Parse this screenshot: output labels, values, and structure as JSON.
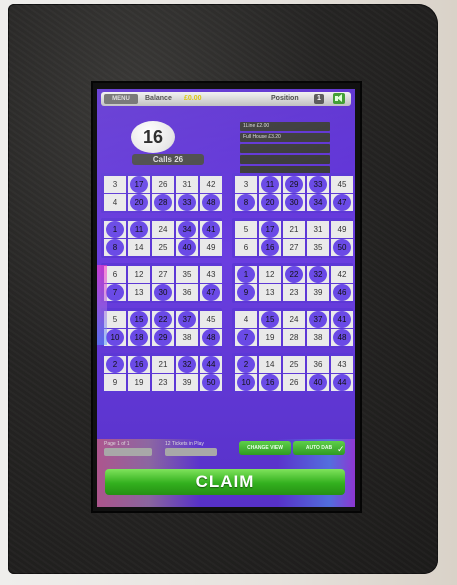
{
  "topbar": {
    "menu_label": "MENU",
    "balance_label": "Balance",
    "balance_value": "£0.00",
    "position_label": "Position",
    "position_value": "1",
    "sound_icon": "speaker-icon"
  },
  "caller": {
    "current_ball": "16",
    "calls_text": "Calls  26"
  },
  "prizes": [
    "1Line £2.00",
    "Full House £3.20",
    "",
    "",
    ""
  ],
  "tickets": [
    [
      {
        "rows": [
          [
            {
              "n": "3",
              "m": false
            },
            {
              "n": "17",
              "m": true
            },
            {
              "n": "26",
              "m": false
            },
            {
              "n": "31",
              "m": false
            },
            {
              "n": "42",
              "m": false
            }
          ],
          [
            {
              "n": "4",
              "m": false
            },
            {
              "n": "20",
              "m": true
            },
            {
              "n": "28",
              "m": true
            },
            {
              "n": "33",
              "m": true
            },
            {
              "n": "48",
              "m": true
            }
          ]
        ]
      },
      {
        "rows": [
          [
            {
              "n": "3",
              "m": false
            },
            {
              "n": "11",
              "m": true
            },
            {
              "n": "29",
              "m": true
            },
            {
              "n": "33",
              "m": true
            },
            {
              "n": "45",
              "m": false
            }
          ],
          [
            {
              "n": "8",
              "m": true
            },
            {
              "n": "20",
              "m": true
            },
            {
              "n": "30",
              "m": true
            },
            {
              "n": "34",
              "m": true
            },
            {
              "n": "47",
              "m": true
            }
          ]
        ]
      }
    ],
    [
      {
        "rows": [
          [
            {
              "n": "1",
              "m": true
            },
            {
              "n": "11",
              "m": true
            },
            {
              "n": "24",
              "m": false
            },
            {
              "n": "34",
              "m": true
            },
            {
              "n": "41",
              "m": true
            }
          ],
          [
            {
              "n": "8",
              "m": true
            },
            {
              "n": "14",
              "m": false
            },
            {
              "n": "25",
              "m": false
            },
            {
              "n": "40",
              "m": true
            },
            {
              "n": "49",
              "m": false
            }
          ]
        ]
      },
      {
        "rows": [
          [
            {
              "n": "5",
              "m": false
            },
            {
              "n": "17",
              "m": true
            },
            {
              "n": "21",
              "m": false
            },
            {
              "n": "31",
              "m": false
            },
            {
              "n": "49",
              "m": false
            }
          ],
          [
            {
              "n": "6",
              "m": false
            },
            {
              "n": "16",
              "m": true
            },
            {
              "n": "27",
              "m": false
            },
            {
              "n": "35",
              "m": false
            },
            {
              "n": "50",
              "m": true
            }
          ]
        ]
      }
    ],
    [
      {
        "rows": [
          [
            {
              "n": "6",
              "m": false
            },
            {
              "n": "12",
              "m": false
            },
            {
              "n": "27",
              "m": false
            },
            {
              "n": "35",
              "m": false
            },
            {
              "n": "43",
              "m": false
            }
          ],
          [
            {
              "n": "7",
              "m": true
            },
            {
              "n": "13",
              "m": false
            },
            {
              "n": "30",
              "m": true
            },
            {
              "n": "36",
              "m": false
            },
            {
              "n": "47",
              "m": true
            }
          ]
        ]
      },
      {
        "rows": [
          [
            {
              "n": "1",
              "m": true
            },
            {
              "n": "12",
              "m": false
            },
            {
              "n": "22",
              "m": true
            },
            {
              "n": "32",
              "m": true
            },
            {
              "n": "42",
              "m": false
            }
          ],
          [
            {
              "n": "9",
              "m": true
            },
            {
              "n": "13",
              "m": false
            },
            {
              "n": "23",
              "m": false
            },
            {
              "n": "39",
              "m": false
            },
            {
              "n": "46",
              "m": true
            }
          ]
        ]
      }
    ],
    [
      {
        "rows": [
          [
            {
              "n": "5",
              "m": false
            },
            {
              "n": "15",
              "m": true
            },
            {
              "n": "22",
              "m": true
            },
            {
              "n": "37",
              "m": true
            },
            {
              "n": "45",
              "m": false
            }
          ],
          [
            {
              "n": "10",
              "m": true
            },
            {
              "n": "18",
              "m": true
            },
            {
              "n": "29",
              "m": true
            },
            {
              "n": "38",
              "m": false
            },
            {
              "n": "48",
              "m": true
            }
          ]
        ]
      },
      {
        "rows": [
          [
            {
              "n": "4",
              "m": false
            },
            {
              "n": "15",
              "m": true
            },
            {
              "n": "24",
              "m": false
            },
            {
              "n": "37",
              "m": true
            },
            {
              "n": "41",
              "m": true
            }
          ],
          [
            {
              "n": "7",
              "m": true
            },
            {
              "n": "19",
              "m": false
            },
            {
              "n": "28",
              "m": false
            },
            {
              "n": "38",
              "m": false
            },
            {
              "n": "48",
              "m": true
            }
          ]
        ]
      }
    ],
    [
      {
        "rows": [
          [
            {
              "n": "2",
              "m": true
            },
            {
              "n": "16",
              "m": true
            },
            {
              "n": "21",
              "m": false
            },
            {
              "n": "32",
              "m": true
            },
            {
              "n": "44",
              "m": true
            }
          ],
          [
            {
              "n": "9",
              "m": false
            },
            {
              "n": "19",
              "m": false
            },
            {
              "n": "23",
              "m": false
            },
            {
              "n": "39",
              "m": false
            },
            {
              "n": "50",
              "m": true
            }
          ]
        ]
      },
      {
        "rows": [
          [
            {
              "n": "2",
              "m": true
            },
            {
              "n": "14",
              "m": false
            },
            {
              "n": "25",
              "m": false
            },
            {
              "n": "36",
              "m": false
            },
            {
              "n": "43",
              "m": false
            }
          ],
          [
            {
              "n": "10",
              "m": true
            },
            {
              "n": "16",
              "m": true
            },
            {
              "n": "26",
              "m": false
            },
            {
              "n": "40",
              "m": true
            },
            {
              "n": "44",
              "m": true
            }
          ]
        ]
      }
    ]
  ],
  "bottom": {
    "page_label": "Page 1 of 1",
    "tickets_label": "12 Tickets in Play",
    "change_view_label": "CHANGE VIEW",
    "autodab_label": "AUTO DAB",
    "check_icon": "check-icon",
    "claim_label": "CLAIM"
  }
}
